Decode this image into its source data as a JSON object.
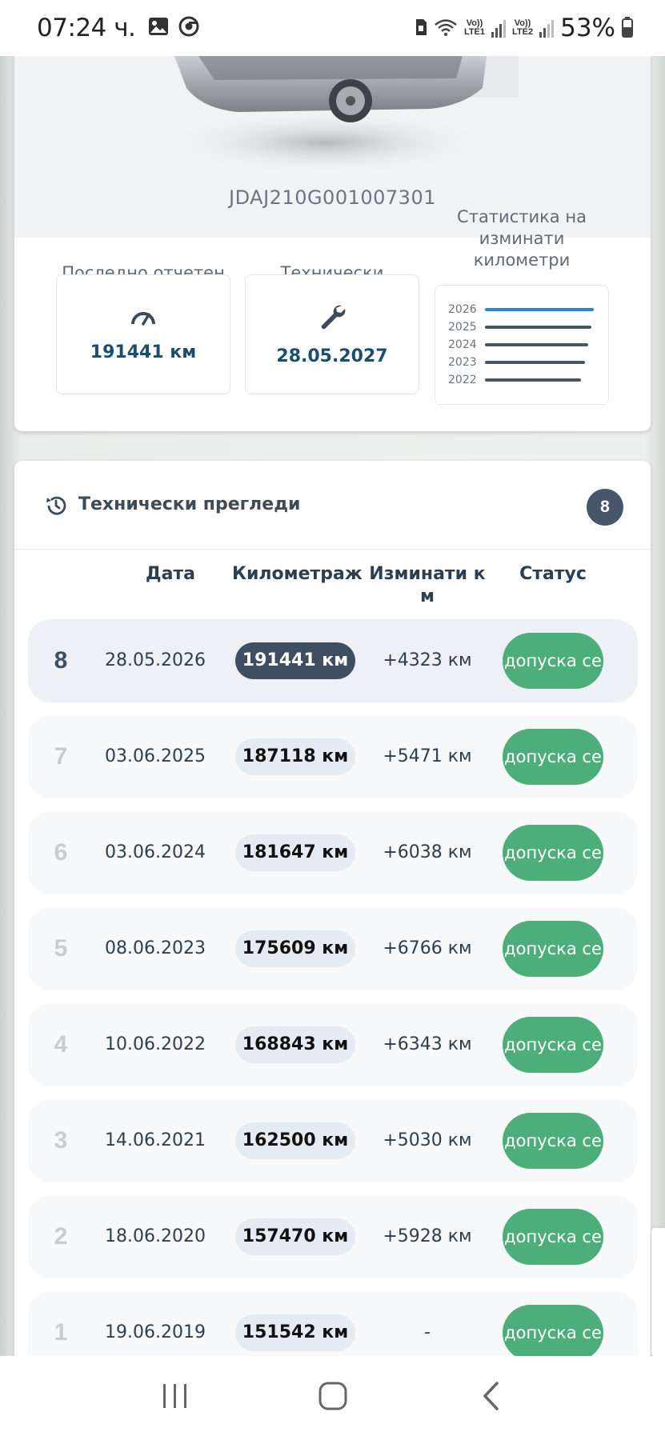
{
  "status_bar": {
    "time": "07:24 ч.",
    "lte1": "LTE1",
    "lte2": "LTE2",
    "volte1": "Vo))",
    "volte2": "Vo))",
    "battery": "53%"
  },
  "vehicle": {
    "vin": "JDAJ210G001007301"
  },
  "stats": {
    "mileage_label": "Последно отчетен километраж",
    "mileage_value": "191441 км",
    "inspection_label": "Технически преглед валиден до",
    "inspection_value": "28.05.2027",
    "chart_label": "Статистика на изминати километри",
    "chart_years": [
      "2026",
      "2025",
      "2024",
      "2023",
      "2022"
    ]
  },
  "inspections": {
    "title": "Технически прегледи",
    "count": "8",
    "columns": {
      "date": "Дата",
      "mileage": "Километраж",
      "traveled": "Изминати к м",
      "status": "Статус"
    },
    "rows": [
      {
        "num": "8",
        "date": "28.05.2026",
        "km": "191441 км",
        "diff": "+4323 км",
        "status": "допуска се"
      },
      {
        "num": "7",
        "date": "03.06.2025",
        "km": "187118 км",
        "diff": "+5471 км",
        "status": "допуска се"
      },
      {
        "num": "6",
        "date": "03.06.2024",
        "km": "181647 км",
        "diff": "+6038 км",
        "status": "допуска се"
      },
      {
        "num": "5",
        "date": "08.06.2023",
        "km": "175609 км",
        "diff": "+6766 км",
        "status": "допуска се"
      },
      {
        "num": "4",
        "date": "10.06.2022",
        "km": "168843 км",
        "diff": "+6343 км",
        "status": "допуска се"
      },
      {
        "num": "3",
        "date": "14.06.2021",
        "km": "162500 км",
        "diff": "+5030 км",
        "status": "допуска се"
      },
      {
        "num": "2",
        "date": "18.06.2020",
        "km": "157470 км",
        "diff": "+5928 км",
        "status": "допуска се"
      },
      {
        "num": "1",
        "date": "19.06.2019",
        "km": "151542 км",
        "diff": "-",
        "status": "допуска се"
      }
    ]
  },
  "colors": {
    "accent_blue": "#2f7ed8",
    "dark_slate": "#3f4e60",
    "status_green": "#4caf7a",
    "value_blue": "#1a4d6e"
  }
}
